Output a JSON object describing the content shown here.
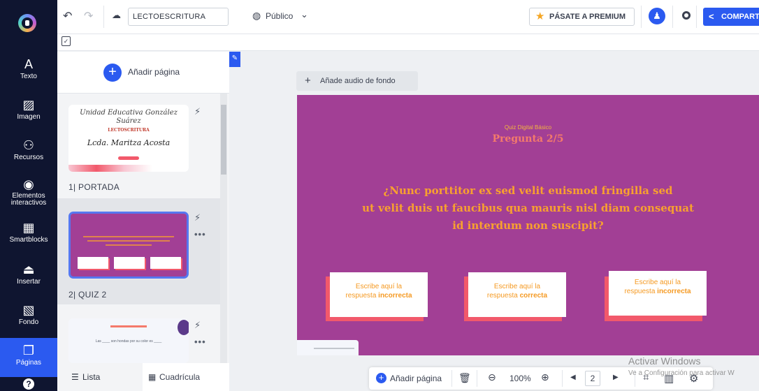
{
  "sidebar": {
    "items": [
      {
        "label": "Texto",
        "icon": "text-icon",
        "glyph": "A"
      },
      {
        "label": "Imagen",
        "icon": "image-icon",
        "glyph": "▨"
      },
      {
        "label": "Recursos",
        "icon": "resources-icon",
        "glyph": "⚇"
      },
      {
        "label": "Elementos interactivos",
        "icon": "interactive-icon",
        "glyph": "◉"
      },
      {
        "label": "Smartblocks",
        "icon": "smartblocks-icon",
        "glyph": "▦"
      },
      {
        "label": "Insertar",
        "icon": "insert-icon",
        "glyph": "⏏"
      },
      {
        "label": "Fondo",
        "icon": "background-icon",
        "glyph": "▧"
      },
      {
        "label": "Páginas",
        "icon": "pages-icon",
        "glyph": "❐"
      }
    ],
    "help_glyph": "?"
  },
  "topbar": {
    "title": "LECTOESCRITURA",
    "visibility": "Público",
    "premium": "PÁSATE A PREMIUM",
    "share": "COMPART"
  },
  "pages_panel": {
    "add_page": "Añadir página",
    "pages": [
      {
        "label": "1| PORTADA",
        "thumb_title": "Unidad Educativa González Suárez",
        "thumb_subtitle": "LECTOSCRITURA",
        "thumb_author": "Lcda. Maritza Acosta"
      },
      {
        "label": "2| QUIZ 2"
      }
    ],
    "third_thumb_text": "Las ____ son hondas por su color es ____",
    "tab_list": "Lista",
    "tab_grid": "Cuadrícula"
  },
  "canvas": {
    "audio_button": "Añade audio de fondo",
    "slide": {
      "kicker": "Quiz Digital Básico",
      "subtitle": "Pregunta 2/5",
      "question_lines": [
        "¿Nunc porttitor ex sed velit euismod fringilla sed",
        "ut velit duis ut faucibus qua  mauris nisl diam consequat",
        "id interdum non suscipit?"
      ],
      "answers": [
        {
          "line1": "Escribe aquí la",
          "line2a": "respuesta ",
          "line2b": "incorrecta"
        },
        {
          "line1": "Escribe aquí la",
          "line2a": "respuesta ",
          "line2b": "correcta"
        },
        {
          "line1": "Escribe aquí la",
          "line2a": "respuesta ",
          "line2b": "incorrecta"
        }
      ]
    }
  },
  "toolbar": {
    "add_page": "Añadir página",
    "zoom": "100%",
    "page_number": "2"
  },
  "watermark": {
    "line1": "Activar Windows",
    "line2": "Ve a Configuración para activar W"
  },
  "colors": {
    "slide_bg": "#a23f95",
    "accent": "#2b5af0",
    "sidebar_bg": "#0f1530",
    "answer_shadow": "#f2596b",
    "question_text": "#f9a12e"
  }
}
